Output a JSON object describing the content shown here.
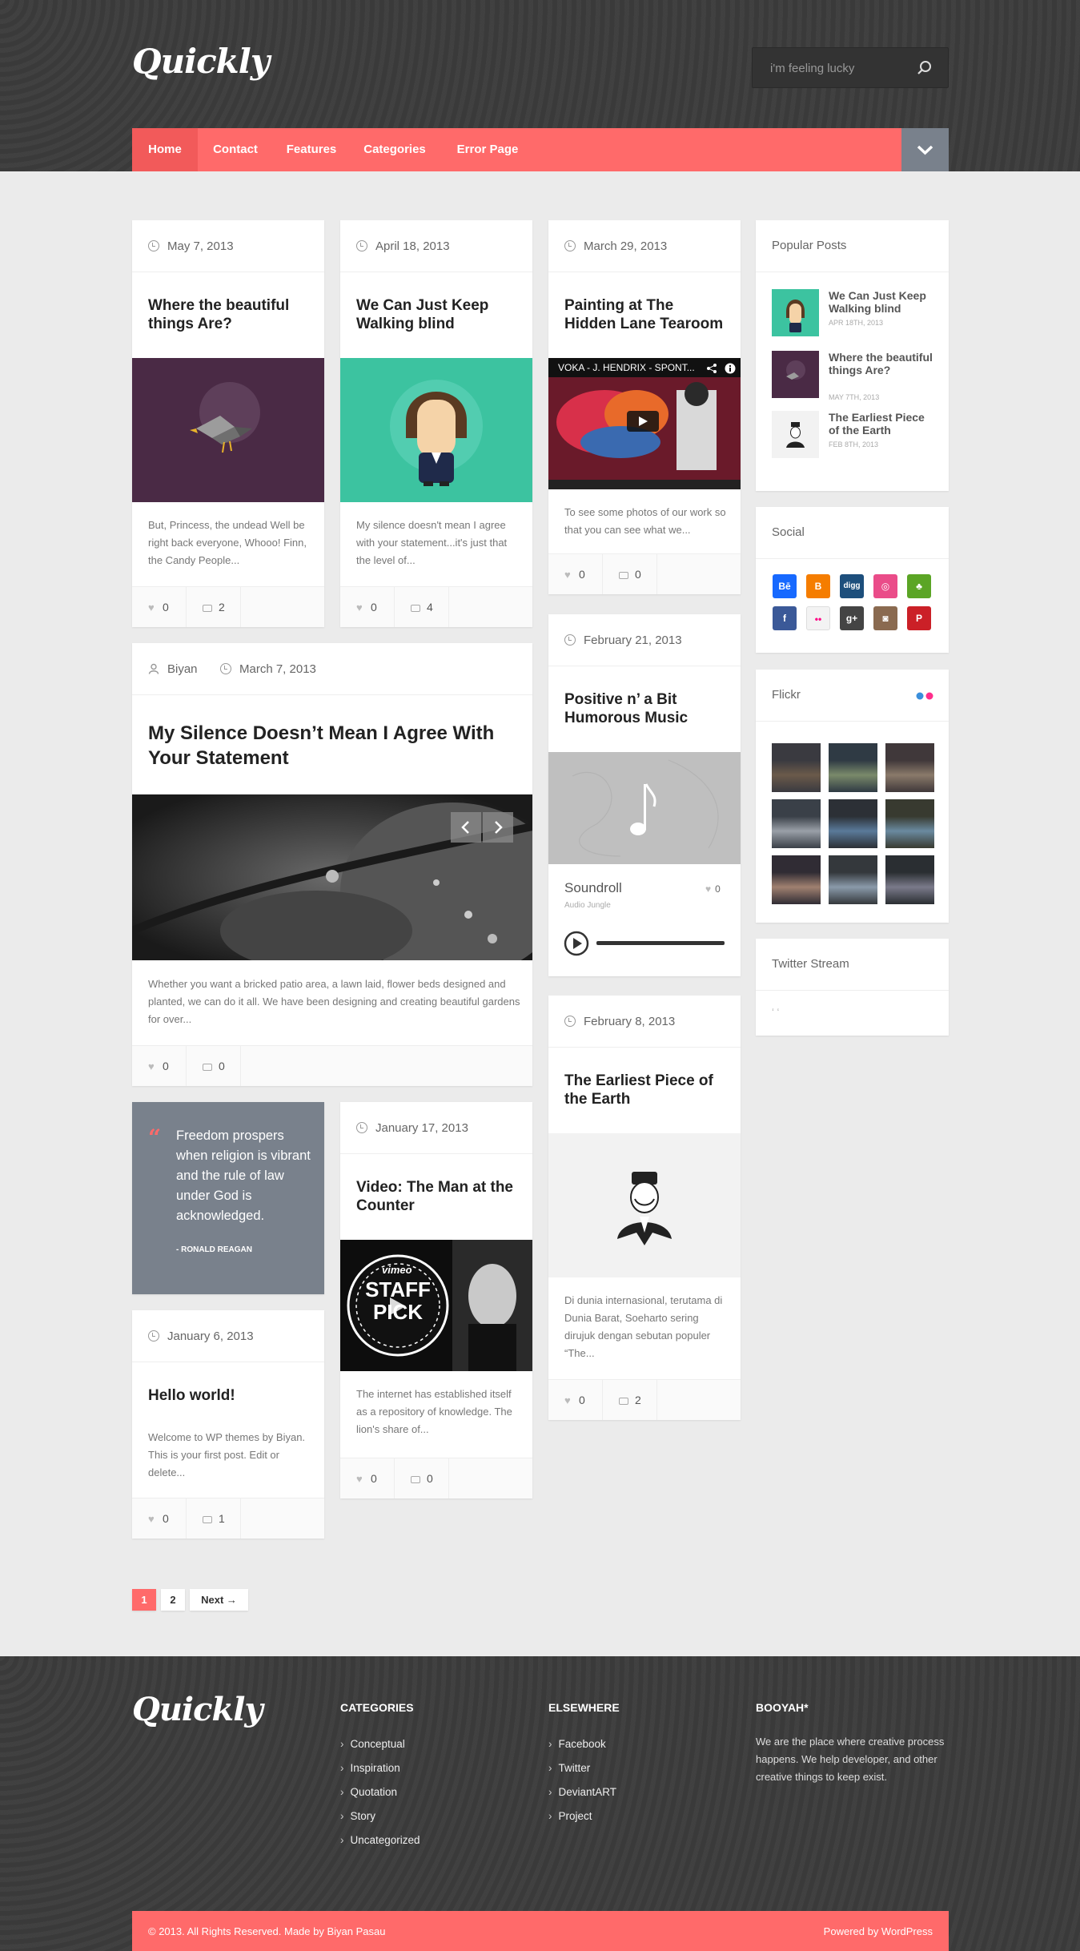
{
  "site": {
    "logo": "Quickly"
  },
  "search": {
    "placeholder": "i'm feeling lucky"
  },
  "nav": {
    "items": [
      "Home",
      "Contact",
      "Features",
      "Categories",
      "Error Page"
    ],
    "active": "Home"
  },
  "posts": {
    "p1": {
      "date": "May 7, 2013",
      "title": "Where the beautiful things Are?",
      "excerpt": "But, Princess, the undead Well be right back everyone, Whooo! Finn, the Candy People...",
      "likes": "0",
      "comments": "2"
    },
    "p2": {
      "date": "April 18, 2013",
      "title": "We Can Just Keep Walking blind",
      "excerpt": "My silence doesn't mean I agree with your statement...it's just that the level of...",
      "likes": "0",
      "comments": "4"
    },
    "p3": {
      "date": "March 29, 2013",
      "title": "Painting at The Hidden Lane Tearoom",
      "video_title": "VOKA - J. HENDRIX - SPONT...",
      "excerpt": "To see some photos of our work so that you can see what we...",
      "likes": "0",
      "comments": "0"
    },
    "p4": {
      "author": "Biyan",
      "date": "March 7, 2013",
      "title": "My Silence Doesn’t Mean I Agree With Your Statement",
      "excerpt": "Whether you want a bricked patio area, a lawn laid, flower beds designed and planted, we can do it all. We have been designing and creating beautiful gardens for over...",
      "likes": "0",
      "comments": "0"
    },
    "p5": {
      "date": "February 21, 2013",
      "title": "Positive n’ a Bit Humorous Music",
      "track": "Soundroll",
      "artist": "Audio Jungle",
      "likes": "0"
    },
    "p6": {
      "date": "February 8, 2013",
      "title": "The Earliest Piece of the Earth",
      "excerpt": "Di dunia internasional, terutama di Dunia Barat, Soeharto sering dirujuk dengan sebutan populer “The...",
      "likes": "0",
      "comments": "2"
    },
    "quote": {
      "text": "Freedom prospers when religion is vibrant and the rule of law under God is acknowledged.",
      "author": "- RONALD REAGAN"
    },
    "p7": {
      "date": "January 17, 2013",
      "title": "Video: The Man at the Counter",
      "vimeo": "vimeo",
      "staff": "STAFF PICK",
      "excerpt": "The internet has established itself as a repository of knowledge. The lion's share of...",
      "likes": "0",
      "comments": "0"
    },
    "p8": {
      "date": "January 6, 2013",
      "title": "Hello world!",
      "excerpt": "Welcome to WP themes by Biyan. This is your first post. Edit or delete...",
      "likes": "0",
      "comments": "1"
    }
  },
  "sidebar": {
    "popular": {
      "title": "Popular Posts",
      "items": [
        {
          "title": "We Can Just Keep Walking blind",
          "date": "APR 18TH, 2013"
        },
        {
          "title": "Where the beautiful things Are?",
          "date": "MAY 7TH, 2013"
        },
        {
          "title": "The Earliest Piece of the Earth",
          "date": "FEB 8TH, 2013"
        }
      ]
    },
    "social": {
      "title": "Social",
      "icons": [
        "Bē",
        "B",
        "digg",
        "◎",
        "♣",
        "f",
        "••",
        "g+",
        "◙",
        "P"
      ]
    },
    "flickr": {
      "title": "Flickr"
    },
    "twitter": {
      "title": "Twitter Stream",
      "content": "‘ ‘"
    }
  },
  "pagination": {
    "pages": [
      "1",
      "2"
    ],
    "next": "Next →"
  },
  "footer": {
    "logo": "Quickly",
    "categories": {
      "title": "CATEGORIES",
      "items": [
        "Conceptual",
        "Inspiration",
        "Quotation",
        "Story",
        "Uncategorized"
      ]
    },
    "elsewhere": {
      "title": "ELSEWHERE",
      "items": [
        "Facebook",
        "Twitter",
        "DeviantART",
        "Project"
      ]
    },
    "booyah": {
      "title": "BOOYAH*",
      "text": "We are the place where creative process happens. We help developer, and other creative things to keep exist."
    },
    "copyright": "© 2013. All Rights Reserved. Made by Biyan Pasau",
    "powered": "Powered by WordPress"
  },
  "colors": {
    "accent": "#ff6a6a",
    "dark": "#3c3c3c",
    "slate": "#79818c"
  }
}
